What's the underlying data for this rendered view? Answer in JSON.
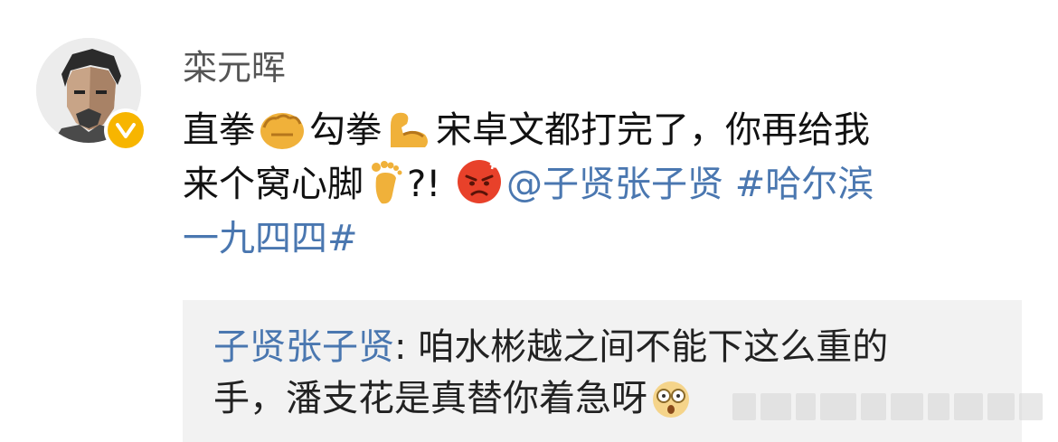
{
  "user": {
    "name": "栾元晖",
    "verified_color": "#f7b500"
  },
  "post": {
    "line1_a": "直拳",
    "line1_b": "勾拳",
    "line1_c": "宋卓文都打完了，你再给我",
    "line2_a": "来个窝心脚",
    "line2_b": "?!",
    "mention": "@子贤张子贤",
    "topic_part1": "#哈尔滨",
    "topic_part2": "一九四四#",
    "icons": [
      "punch-emoji",
      "muscle-emoji",
      "foot-emoji",
      "angry-face-emoji"
    ]
  },
  "quote": {
    "author": "子贤张子贤",
    "separator": ": ",
    "line1": "咱水彬越之间不能下这么重的",
    "line2": "手，潘支花是真替你着急呀",
    "icons": [
      "shocked-face-emoji"
    ]
  },
  "colors": {
    "link": "#4a77b0",
    "text": "#111111",
    "username": "#555555",
    "quote_bg": "#f2f2f2"
  }
}
